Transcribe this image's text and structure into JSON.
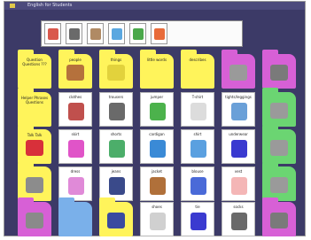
{
  "window": {
    "title": "English for Students"
  },
  "strip_icons": [
    {
      "icon": "people-pair-icon",
      "color": "#d9584c"
    },
    {
      "icon": "scene-picture-icon",
      "color": "#6a6a6a"
    },
    {
      "icon": "person-icon",
      "color": "#b08a64"
    },
    {
      "icon": "clothing-icon",
      "color": "#5aa7e0"
    },
    {
      "icon": "framed-picture-icon",
      "color": "#4aa84a"
    },
    {
      "icon": "colorful-ball-icon",
      "color": "#e86b3a"
    }
  ],
  "rows": [
    [
      {
        "kind": "folder",
        "color": "yellow",
        "label": "Question Questions ???",
        "icon": ""
      },
      {
        "kind": "folder",
        "color": "yellow",
        "label": "people",
        "icon": "people-icon"
      },
      {
        "kind": "folder",
        "color": "yellow",
        "label": "things",
        "icon": "things-icon"
      },
      {
        "kind": "folder",
        "color": "yellow",
        "label": "little words",
        "icon": ""
      },
      {
        "kind": "folder",
        "color": "yellow",
        "label": "describes",
        "icon": ""
      },
      {
        "kind": "folder",
        "color": "pink",
        "label": "",
        "icon": "picture-icon"
      },
      {
        "kind": "folder",
        "color": "pink",
        "label": "",
        "icon": "trash-can-icon"
      }
    ],
    [
      {
        "kind": "folder",
        "color": "yellow",
        "label": "Helper Phrases Questions",
        "icon": ""
      },
      {
        "kind": "word",
        "label": "clothes",
        "icon": "clothes-pile-icon"
      },
      {
        "kind": "word",
        "label": "trousers",
        "icon": "trousers-icon"
      },
      {
        "kind": "word",
        "label": "jumper",
        "icon": "jumper-icon"
      },
      {
        "kind": "word",
        "label": "T-shirt",
        "icon": "tshirt-icon"
      },
      {
        "kind": "word",
        "label": "tights/leggings",
        "icon": "tights-icon"
      },
      {
        "kind": "folder",
        "color": "green",
        "label": "",
        "icon": "picture-icon"
      }
    ],
    [
      {
        "kind": "folder",
        "color": "yellow",
        "label": "Talk Talk",
        "icon": "lips-icon"
      },
      {
        "kind": "word",
        "label": "skirt",
        "icon": "skirt-icon"
      },
      {
        "kind": "word",
        "label": "shorts",
        "icon": "shorts-icon"
      },
      {
        "kind": "word",
        "label": "cardigan",
        "icon": "cardigan-icon"
      },
      {
        "kind": "word",
        "label": "shirt",
        "icon": "shirt-icon"
      },
      {
        "kind": "word",
        "label": "underwear",
        "icon": "underwear-icon"
      },
      {
        "kind": "folder",
        "color": "green",
        "label": "",
        "icon": "picture-icon"
      }
    ],
    [
      {
        "kind": "folder",
        "color": "yellow",
        "label": "",
        "icon": "keyboard-icon"
      },
      {
        "kind": "word",
        "label": "dress",
        "icon": "dress-icon"
      },
      {
        "kind": "word",
        "label": "jeans",
        "icon": "jeans-icon"
      },
      {
        "kind": "word",
        "label": "jacket",
        "icon": "jacket-icon"
      },
      {
        "kind": "word",
        "label": "blouse",
        "icon": "blouse-icon"
      },
      {
        "kind": "word",
        "label": "vest",
        "icon": "vest-icon"
      },
      {
        "kind": "folder",
        "color": "green",
        "label": "",
        "icon": "picture-icon"
      }
    ],
    [
      {
        "kind": "folder",
        "color": "pink",
        "label": "",
        "icon": "toolbox-icon"
      },
      {
        "kind": "folder",
        "color": "blue",
        "label": "",
        "icon": ""
      },
      {
        "kind": "folder",
        "color": "yellow",
        "label": "",
        "icon": "compass-icon"
      },
      {
        "kind": "word",
        "label": "shoes",
        "icon": "shoes-icon"
      },
      {
        "kind": "word",
        "label": "tie",
        "icon": "tie-icon"
      },
      {
        "kind": "word",
        "label": "socks",
        "icon": "socks-icon"
      },
      {
        "kind": "folder",
        "color": "pink",
        "label": "",
        "icon": "trash-can-icon"
      }
    ]
  ],
  "icon_colors": {
    "people-icon": "#b5713c",
    "things-icon": "#e2d23c",
    "picture-icon": "#9a9a9a",
    "trash-can-icon": "#7a7a7a",
    "clothes-pile-icon": "#c0504d",
    "trousers-icon": "#6a6a6a",
    "jumper-icon": "#4cb24c",
    "tshirt-icon": "#dcdcdc",
    "tights-icon": "#6aa0d8",
    "lips-icon": "#d8303a",
    "skirt-icon": "#e054c8",
    "shorts-icon": "#4cae6a",
    "cardigan-icon": "#3a8ad6",
    "shirt-icon": "#5aa0e0",
    "underwear-icon": "#3a3ad0",
    "keyboard-icon": "#8c8c8c",
    "dress-icon": "#e08ad8",
    "jeans-icon": "#3a4a8a",
    "jacket-icon": "#b0703a",
    "blouse-icon": "#4a6ad8",
    "vest-icon": "#f4b6b6",
    "toolbox-icon": "#8a8a8a",
    "compass-icon": "#3a4aa0",
    "shoes-icon": "#d0d0d0",
    "tie-icon": "#3a3ad0",
    "socks-icon": "#6a6a6a"
  }
}
